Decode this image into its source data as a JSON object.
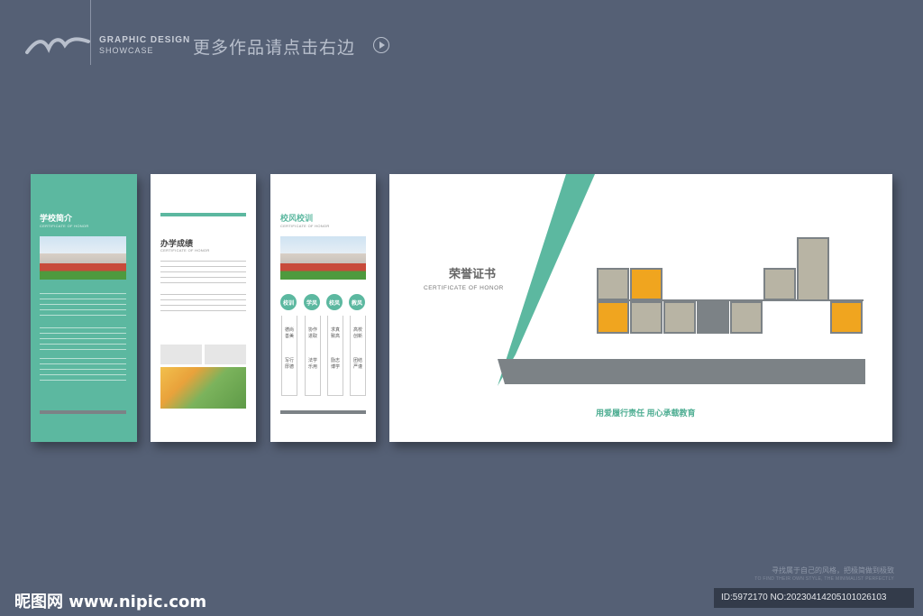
{
  "header": {
    "brand_line1": "GRAPHIC DESIGN",
    "brand_line2": "SHOWCASE",
    "more_text": "更多作品请点击右边"
  },
  "panel1": {
    "title": "学校简介",
    "subtitle": "CERTIFICATE OF HONOR"
  },
  "panel2": {
    "title": "办学成绩",
    "subtitle": "CERTIFICATE OF HONOR"
  },
  "panel3": {
    "title": "校风校训",
    "subtitle": "CERTIFICATE OF HONOR",
    "circles": [
      "校训",
      "学风",
      "校风",
      "教风"
    ],
    "mottos": [
      "德尚善美",
      "求真致高",
      "协作进取",
      "励志博学",
      "写行厚德",
      "法学乐用",
      "高校创新",
      "团结严谨"
    ]
  },
  "panel4": {
    "title": "荣誉证书",
    "subtitle": "CERTIFICATE OF HONOR",
    "slogan": "用爱履行责任   用心承载教育",
    "colors": {
      "accent": "#5cb8a0",
      "orange": "#f0a51f",
      "gray": "#b8b4a4",
      "dark": "#7c8286"
    }
  },
  "footer": {
    "tagline": "寻找属于自己的风格，把极简做到极致",
    "tagline_en": "TO FIND THEIR OWN STYLE, THE MINIMALIST PERFECTLY",
    "site": "昵图网 www.nipic.com",
    "id_text": "ID:5972170 NO:20230414205101026103"
  }
}
